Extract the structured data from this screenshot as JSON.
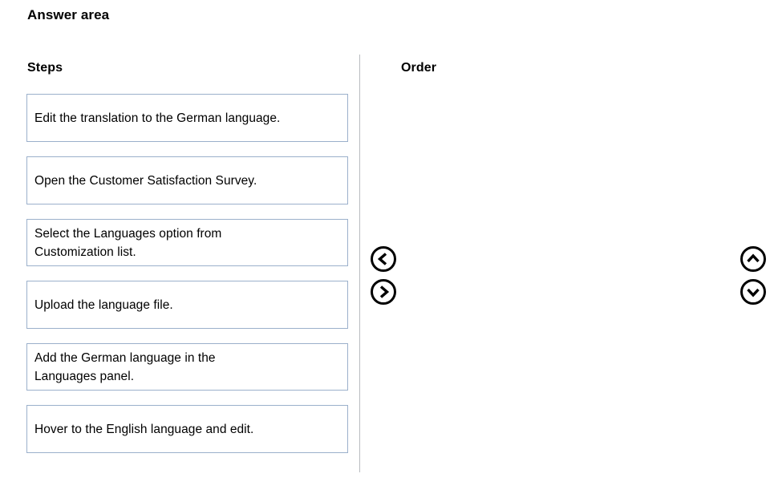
{
  "page": {
    "title": "Answer area"
  },
  "columns": {
    "steps_label": "Steps",
    "order_label": "Order"
  },
  "steps": [
    {
      "lines": [
        "Edit the translation to the German language."
      ]
    },
    {
      "lines": [
        "Open the Customer Satisfaction Survey."
      ]
    },
    {
      "lines": [
        "Select the Languages option from",
        "Customization list."
      ]
    },
    {
      "lines": [
        "Upload the language file."
      ]
    },
    {
      "lines": [
        "Add the German language in the",
        "Languages panel."
      ]
    },
    {
      "lines": [
        "Hover to the English language and edit."
      ]
    }
  ],
  "order": {
    "items": []
  },
  "controls": {
    "move_left": {
      "icon": "chevron-left-circle-icon",
      "label": "Move left"
    },
    "move_right": {
      "icon": "chevron-right-circle-icon",
      "label": "Move right"
    },
    "move_up": {
      "icon": "chevron-up-circle-icon",
      "label": "Move up"
    },
    "move_down": {
      "icon": "chevron-down-circle-icon",
      "label": "Move down"
    }
  },
  "colors": {
    "box_border": "#9bb0cb",
    "divider": "#b9bcc0",
    "text": "#000000",
    "background": "#ffffff",
    "icon": "#000000"
  }
}
